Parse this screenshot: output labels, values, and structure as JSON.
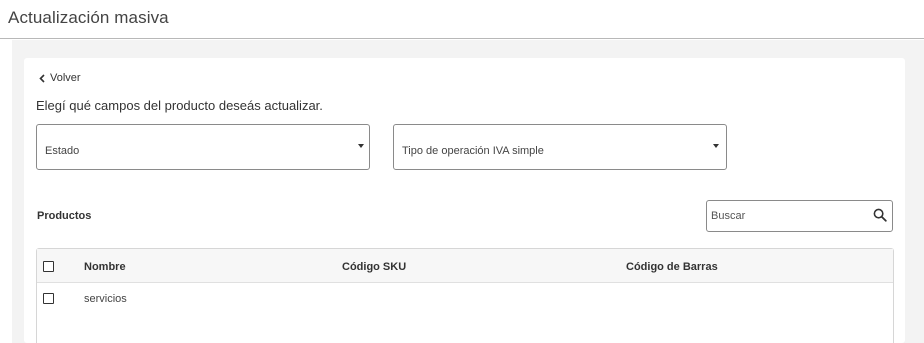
{
  "header": {
    "title": "Actualización masiva"
  },
  "nav": {
    "back_label": "Volver"
  },
  "form": {
    "instructions": "Elegí qué campos del producto deseás actualizar.",
    "select_estado": {
      "label": "Estado"
    },
    "select_iva": {
      "label": "Tipo de operación IVA simple"
    }
  },
  "products": {
    "title": "Productos",
    "search_placeholder": "Buscar",
    "columns": {
      "name": "Nombre",
      "sku": "Código SKU",
      "barcode": "Código de Barras"
    },
    "rows": [
      {
        "name": "servicios",
        "sku": "",
        "barcode": ""
      }
    ]
  }
}
